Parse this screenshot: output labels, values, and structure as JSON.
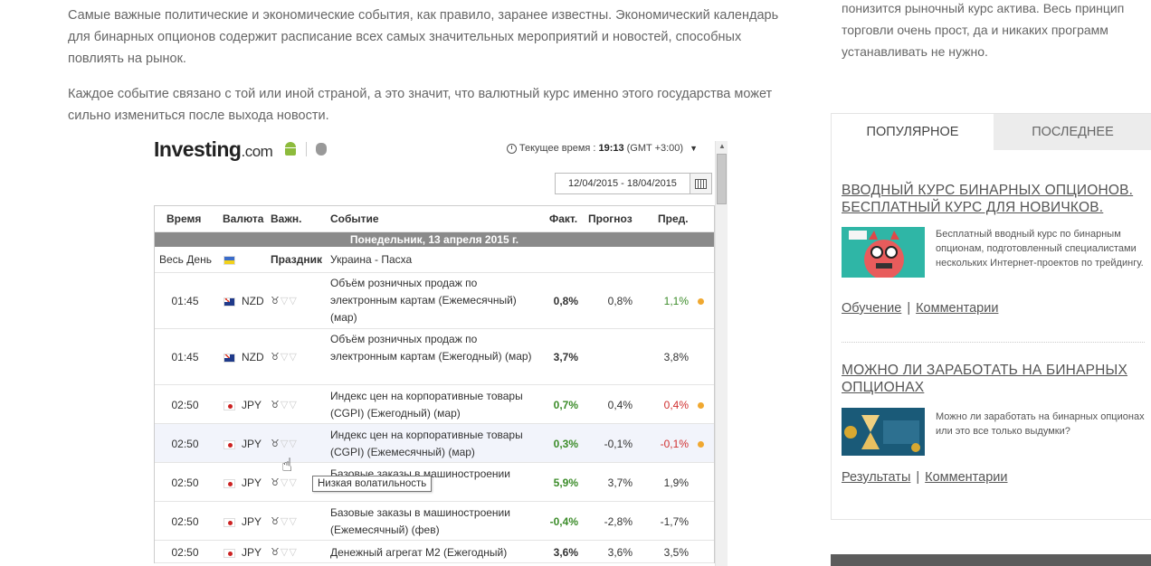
{
  "article": {
    "para1": "Самые важные политические и экономические события, как правило, заранее известны. Экономический календарь для бинарных опционов содержит расписание всех самых значительных мероприятий и новостей, способных повлиять на рынок.",
    "para2": "Каждое событие связано с той или иной страной, а это значит, что валютный курс именно этого государства может сильно измениться после выхода новости."
  },
  "widget": {
    "logo_main": "Investing",
    "logo_suffix": ".com",
    "time_label": "Текущее время :",
    "time_value": "19:13",
    "time_zone": "(GMT +3:00)",
    "date_range": "12/04/2015 - 18/04/2015",
    "headers": {
      "time": "Время",
      "currency": "Валюта",
      "importance": "Важн.",
      "event": "Событие",
      "actual": "Факт.",
      "forecast": "Прогноз",
      "previous": "Пред."
    },
    "day_band": "Понедельник, 13 апреля 2015 г.",
    "holiday": {
      "time": "Весь День",
      "label": "Праздник",
      "event": "Украина - Пасха"
    },
    "events": [
      {
        "time": "01:45",
        "flag": "nz",
        "currency": "NZD",
        "event": "Объём розничных продаж по электронным картам (Ежемесячный) (мар)",
        "actual": "0,8%",
        "actual_color": "black",
        "forecast": "0,8%",
        "previous": "1,1%",
        "previous_color": "green",
        "dot": true
      },
      {
        "time": "01:45",
        "flag": "nz",
        "currency": "NZD",
        "event": "Объём розничных продаж по электронным картам (Ежегодный) (мар)",
        "actual": "3,7%",
        "actual_color": "black",
        "forecast": "",
        "previous": "3,8%",
        "previous_color": "black",
        "dot": false
      },
      {
        "time": "02:50",
        "flag": "jp",
        "currency": "JPY",
        "event": "Индекс цен на корпоративные товары (CGPI) (Ежегодный) (мар)",
        "actual": "0,7%",
        "actual_color": "green",
        "forecast": "0,4%",
        "previous": "0,4%",
        "previous_color": "red",
        "dot": true
      },
      {
        "time": "02:50",
        "flag": "jp",
        "currency": "JPY",
        "event": "Индекс цен на корпоративные товары (CGPI) (Ежемесячный) (мар)",
        "actual": "0,3%",
        "actual_color": "green",
        "forecast": "-0,1%",
        "previous": "-0,1%",
        "previous_color": "red",
        "dot": true
      },
      {
        "time": "02:50",
        "flag": "jp",
        "currency": "JPY",
        "event": "Базовые заказы в машиностроении",
        "actual": "5,9%",
        "actual_color": "green",
        "forecast": "3,7%",
        "previous": "1,9%",
        "previous_color": "black",
        "dot": false
      },
      {
        "time": "02:50",
        "flag": "jp",
        "currency": "JPY",
        "event": "Базовые заказы в машиностроении (Ежемесячный) (фев)",
        "actual": "-0,4%",
        "actual_color": "green",
        "forecast": "-2,8%",
        "previous": "-1,7%",
        "previous_color": "black",
        "dot": false
      },
      {
        "time": "02:50",
        "flag": "jp",
        "currency": "JPY",
        "event": "Денежный агрегат М2 (Ежегодный)",
        "actual": "3,6%",
        "actual_color": "black",
        "forecast": "3,6%",
        "previous": "3,5%",
        "previous_color": "black",
        "dot": false
      }
    ],
    "tooltip": "Низкая волатильность"
  },
  "sidebar": {
    "top_text": "понизится рыночный курс актива. Весь принцип торговли очень прост, да и никаких программ устанавливать не нужно.",
    "tab_popular": "ПОПУЛЯРНОЕ",
    "tab_latest": "ПОСЛЕДНЕЕ",
    "post1": {
      "title": "ВВОДНЫЙ КУРС БИНАРНЫХ ОПЦИОНОВ. БЕСПЛАТНЫЙ КУРС ДЛЯ НОВИЧКОВ.",
      "desc": "Бесплатный вводный курс по бинарным опционам, подготовленный специалистами нескольких Интернет-проектов по трейдингу.",
      "link1": "Обучение",
      "link2": "Комментарии"
    },
    "post2": {
      "title": "МОЖНО ЛИ ЗАРАБОТАТЬ НА БИНАРНЫХ ОПЦИОНАХ",
      "desc": "Можно ли заработать на бинарных опционах или это все только выдумки?",
      "link1": "Результаты",
      "link2": "Комментарии"
    },
    "separator": "|"
  },
  "colors": {
    "green": "#3c8c2a",
    "red": "#d03030",
    "day_band": "#8a8a8a",
    "dot": "#f0a830"
  }
}
